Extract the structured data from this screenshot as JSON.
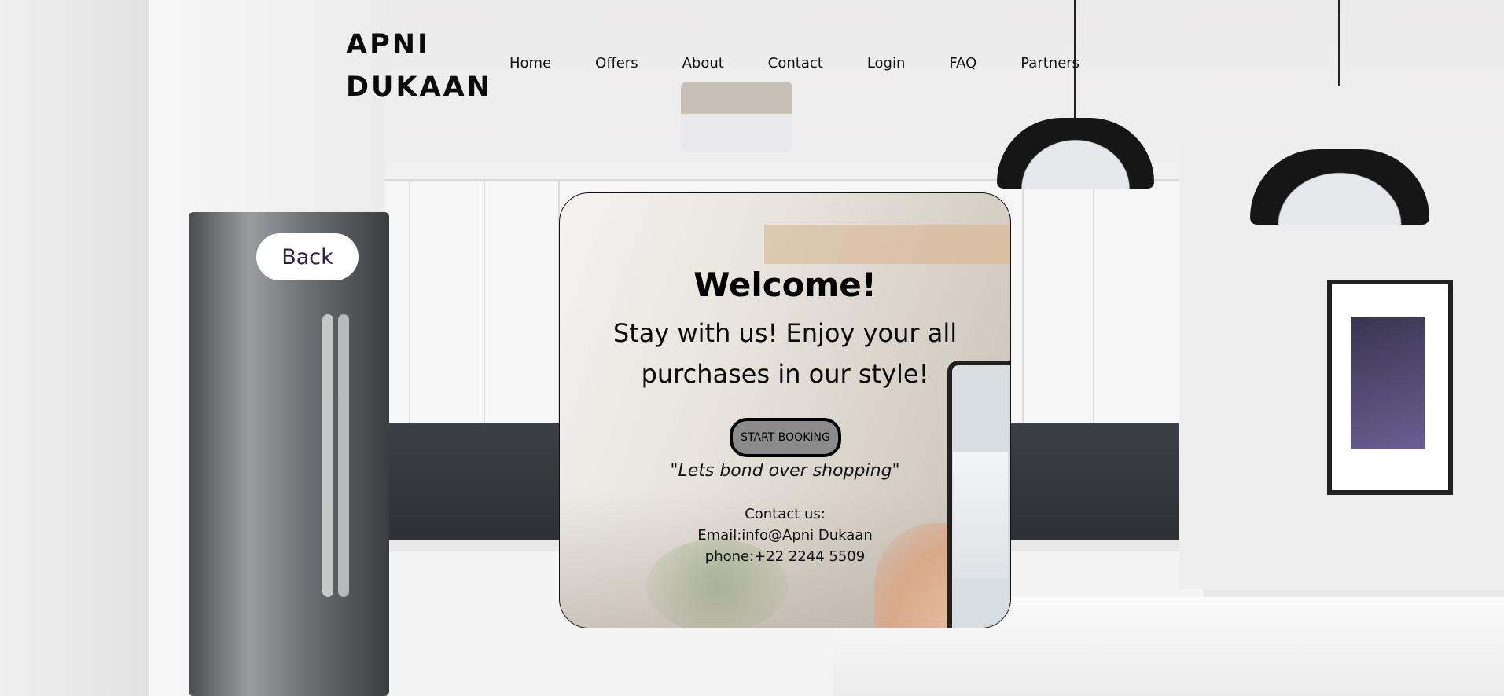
{
  "brand": {
    "line1": "APNI",
    "line2": "DUKAAN"
  },
  "nav": {
    "items": [
      "Home",
      "Offers",
      "About",
      "Contact",
      "Login",
      "FAQ",
      "Partners"
    ]
  },
  "back_label": "Back",
  "card": {
    "title": "Welcome!",
    "tagline": "Stay with us! Enjoy your all purchases in our style!",
    "cta_label": "START BOOKING",
    "quote": "\"Lets bond over shopping\"",
    "contact_heading": "Contact us:",
    "email_line": "Email:info@Apni Dukaan",
    "phone_line": "phone:+22 2244 5509"
  }
}
